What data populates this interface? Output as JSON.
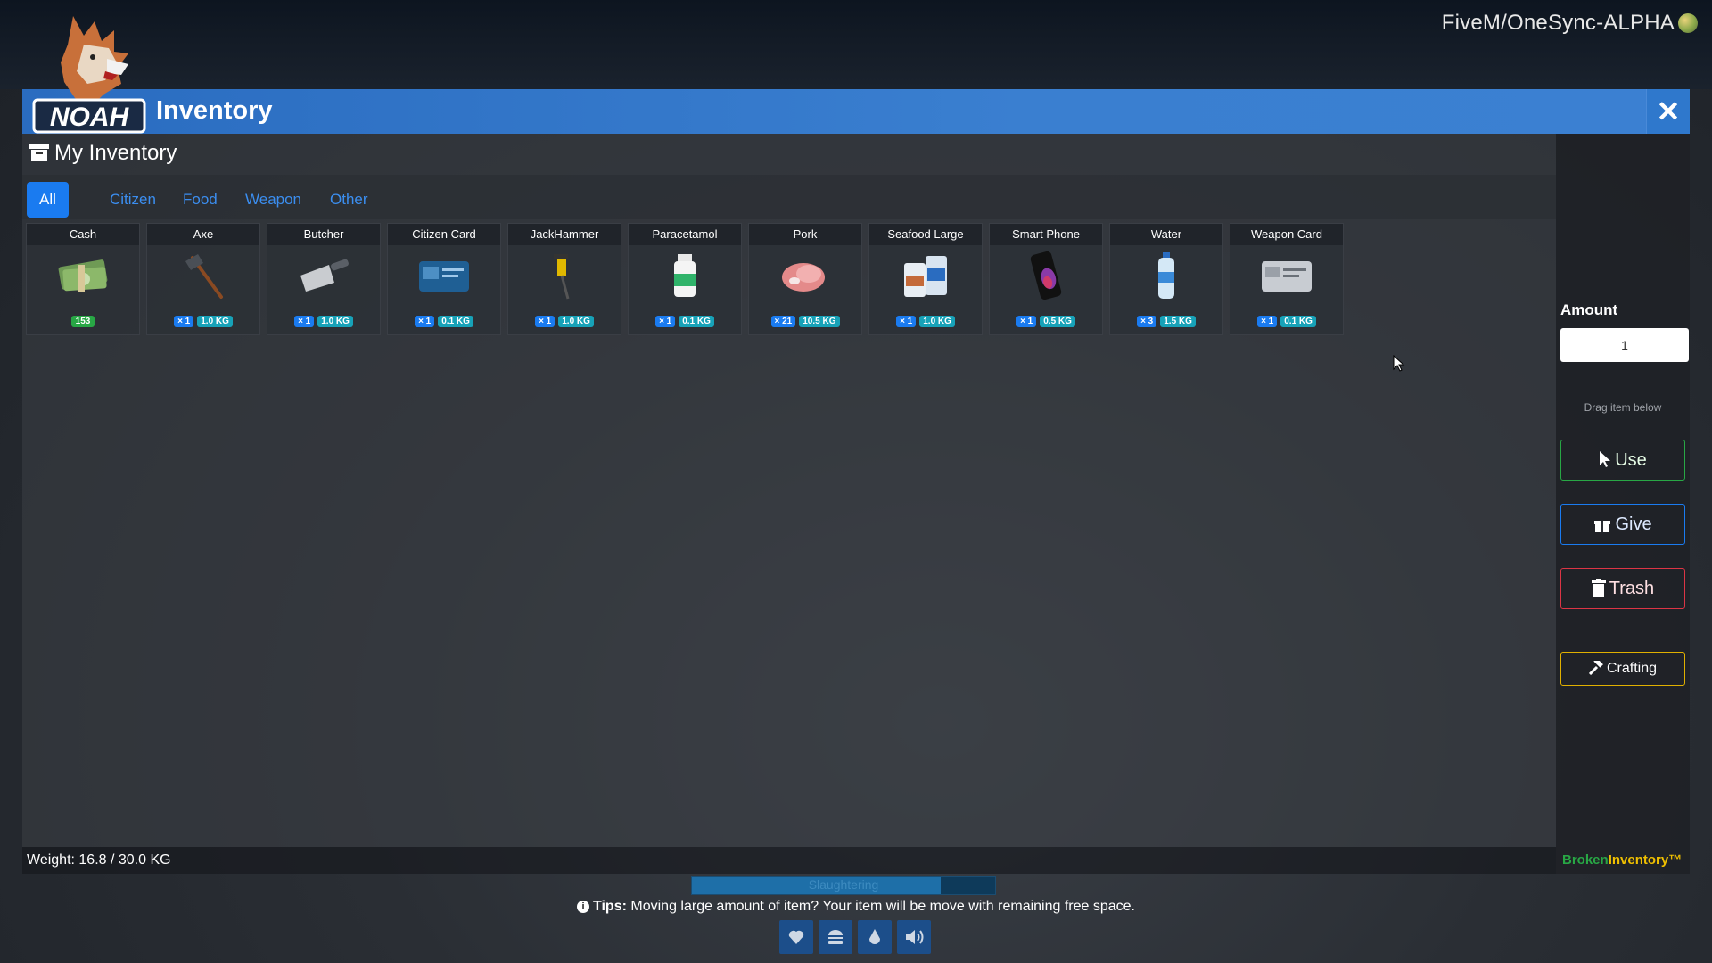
{
  "server": {
    "name": "FiveM/OneSync-ALPHA"
  },
  "window": {
    "title": "Inventory",
    "close_label": "✕"
  },
  "panel": {
    "header": "My Inventory"
  },
  "tabs": [
    {
      "label": "All",
      "active": true
    },
    {
      "label": "Citizen"
    },
    {
      "label": "Food"
    },
    {
      "label": "Weapon"
    },
    {
      "label": "Other"
    }
  ],
  "items": [
    {
      "name": "Cash",
      "icon": "cash-icon",
      "cash": "153"
    },
    {
      "name": "Axe",
      "icon": "axe-icon",
      "count": "× 1",
      "weight": "1.0 KG"
    },
    {
      "name": "Butcher",
      "icon": "cleaver-icon",
      "count": "× 1",
      "weight": "1.0 KG"
    },
    {
      "name": "Citizen Card",
      "icon": "id-card-icon",
      "count": "× 1",
      "weight": "0.1 KG"
    },
    {
      "name": "JackHammer",
      "icon": "jackhammer-icon",
      "count": "× 1",
      "weight": "1.0 KG"
    },
    {
      "name": "Paracetamol",
      "icon": "pill-bottle-icon",
      "count": "× 1",
      "weight": "0.1 KG"
    },
    {
      "name": "Pork",
      "icon": "pork-icon",
      "count": "× 21",
      "weight": "10.5 KG"
    },
    {
      "name": "Seafood Large",
      "icon": "seafood-icon",
      "count": "× 1",
      "weight": "1.0 KG"
    },
    {
      "name": "Smart Phone",
      "icon": "phone-icon",
      "count": "× 1",
      "weight": "0.5 KG"
    },
    {
      "name": "Water",
      "icon": "water-bottle-icon",
      "count": "× 3",
      "weight": "1.5 KG"
    },
    {
      "name": "Weapon Card",
      "icon": "weapon-card-icon",
      "count": "× 1",
      "weight": "0.1 KG"
    }
  ],
  "weight": {
    "text": "Weight: 16.8 / 30.0 KG"
  },
  "sidebar": {
    "amount_label": "Amount",
    "amount_value": "1",
    "drag_hint": "Drag item below",
    "use_label": "Use",
    "give_label": "Give",
    "trash_label": "Trash",
    "crafting_label": "Crafting",
    "brand_part1": "Broken",
    "brand_part2": "Inventory™"
  },
  "progress": {
    "label": "Slaughtering",
    "percent": 0.82
  },
  "tips": {
    "label": "Tips:",
    "text": " Moving large amount of item? Your item will be move with remaining free space."
  },
  "colors": {
    "accent": "#1a7bf0",
    "titlebar": "#3a7fd0",
    "weight_badge": "#17a2b8",
    "cash_badge": "#28a745",
    "use": "#28a745",
    "trash": "#dc3545",
    "crafting": "#e0b000"
  }
}
